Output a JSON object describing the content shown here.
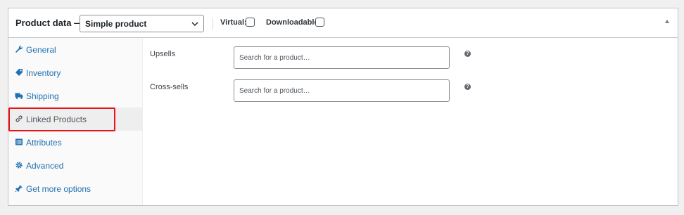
{
  "header": {
    "title": "Product data —",
    "product_type": "Simple product",
    "virtual_label": "Virtual:",
    "downloadable_label": "Downloadable:",
    "virtual_checked": false,
    "downloadable_checked": false
  },
  "sidebar": {
    "items": [
      {
        "label": "General",
        "icon": "wrench-icon",
        "active": false
      },
      {
        "label": "Inventory",
        "icon": "tag-icon",
        "active": false
      },
      {
        "label": "Shipping",
        "icon": "truck-icon",
        "active": false
      },
      {
        "label": "Linked Products",
        "icon": "link-icon",
        "active": true
      },
      {
        "label": "Attributes",
        "icon": "list-icon",
        "active": false
      },
      {
        "label": "Advanced",
        "icon": "gear-icon",
        "active": false
      },
      {
        "label": "Get more options",
        "icon": "plugin-icon",
        "active": false
      }
    ]
  },
  "linked": {
    "upsells_label": "Upsells",
    "upsells_placeholder": "Search for a product…",
    "crosssells_label": "Cross-sells",
    "crosssells_placeholder": "Search for a product…",
    "help_glyph": "?"
  },
  "colors": {
    "link": "#2271b1",
    "highlight": "#e8141a",
    "active_tab_bg": "#eeeeee"
  }
}
